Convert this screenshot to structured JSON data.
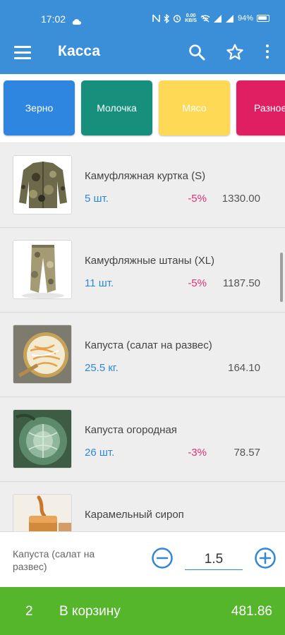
{
  "status_bar": {
    "time": "17:02",
    "net_speed_value": "0.00",
    "net_speed_unit": "KB/S",
    "battery": "94%"
  },
  "app_bar": {
    "title": "Касса",
    "icons": [
      "menu-icon",
      "search-icon",
      "star-icon",
      "more-vertical-icon"
    ]
  },
  "categories": [
    {
      "label": "Зерно",
      "color": "#2f86e0"
    },
    {
      "label": "Молочка",
      "color": "#168f7c"
    },
    {
      "label": "Мясо",
      "color": "#fdd956"
    },
    {
      "label": "Разное",
      "color": "#e01f63"
    }
  ],
  "products": [
    {
      "name": "Камуфляжная куртка (S)",
      "qty": "5 шт.",
      "discount": "-5%",
      "price": "1330.00",
      "image": "camo-jacket"
    },
    {
      "name": "Камуфляжные штаны (XL)",
      "qty": "11 шт.",
      "discount": "-5%",
      "price": "1187.50",
      "image": "camo-pants"
    },
    {
      "name": "Капуста (салат на развес)",
      "qty": "25.5 кг.",
      "discount": "",
      "price": "164.10",
      "image": "cabbage-salad"
    },
    {
      "name": "Капуста огородная",
      "qty": "26 шт.",
      "discount": "-3%",
      "price": "78.57",
      "image": "cabbage"
    },
    {
      "name": "Карамельный сироп",
      "qty": "",
      "discount": "",
      "price": "",
      "image": "caramel-syrup"
    }
  ],
  "editor": {
    "product_name": "Капуста (салат на развес)",
    "quantity": "1.5"
  },
  "cart": {
    "count": "2",
    "label": "В корзину",
    "total": "481.86"
  },
  "colors": {
    "primary": "#3b8fd9",
    "accent_blue": "#2e88d6",
    "discount": "#e0307a",
    "cart_green": "#55b52b"
  }
}
